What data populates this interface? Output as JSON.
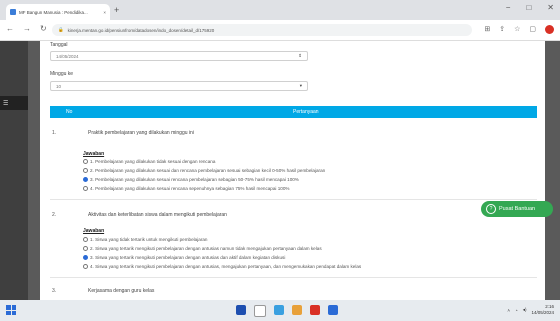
{
  "browser": {
    "tab_title": "MF Bangun Manusia : Pendidika...",
    "tab_close": "×",
    "new_tab": "+",
    "url": "kinerja.mentan.go.id/pensiunfrom/datadosen/indo_dosen/detail_d/175920",
    "window_controls": [
      "−",
      "□",
      "✕"
    ]
  },
  "form": {
    "date_label": "Tanggal",
    "date_value": "14/05/2024",
    "period_label": "Minggu ke",
    "period_value": "10",
    "table_col_no": "No",
    "table_col_question": "Pertanyaan"
  },
  "questions": [
    {
      "number": "1.",
      "text": "Praktik pembelajaran yang dilakukan minggu ini",
      "answer_label": "Jawaban",
      "options": [
        {
          "label": "1. Pembelajaran yang dilakukan tidak sesuai dengan rencana",
          "selected": false
        },
        {
          "label": "2. Pembelajaran yang dilakukan sesuai dan rencana pembelajaran sesuai sebagian kecil 0-50% hasil pembelajaran",
          "selected": false
        },
        {
          "label": "3. Pembelajaran yang dilakukan sesuai rencana pembelajaran sebagian 50-75% hasil mencapai 100%",
          "selected": true
        },
        {
          "label": "4. Pembelajaran yang dilakukan sesuai rencana sepenuhnya sebagian 75% hasil mencapai 100%",
          "selected": false
        }
      ]
    },
    {
      "number": "2.",
      "text": "Aktivitas dan keterlibatan siswa dalam mengikuti pembelajaran",
      "answer_label": "Jawaban",
      "options": [
        {
          "label": "1. Siswa yang tidak tertarik untuk mengikuti pembelajaran",
          "selected": false
        },
        {
          "label": "2. Siswa yang tertarik mengikuti pembelajaran dengan antusias namun tidak mengajukan pertanyaan dalam kelas",
          "selected": false
        },
        {
          "label": "3. Siswa yang tertarik mengikuti pembelajaran dengan antusias dan aktif dalam kegiatan diskusi",
          "selected": true
        },
        {
          "label": "4. Siswa yang tertarik mengikuti pembelajaran dengan antusias, mengajukan pertanyaan, dan mengemukakan pendapat dalam kelas",
          "selected": false
        }
      ]
    },
    {
      "number": "3.",
      "text": "Kerjasama dengan guru kelas"
    }
  ],
  "help_button": "Pusat Bantuan",
  "taskbar": {
    "time": "2:16",
    "date": "14/05/2024"
  },
  "colors": {
    "header_blue": "#00a8e6",
    "help_green": "#34a853"
  }
}
